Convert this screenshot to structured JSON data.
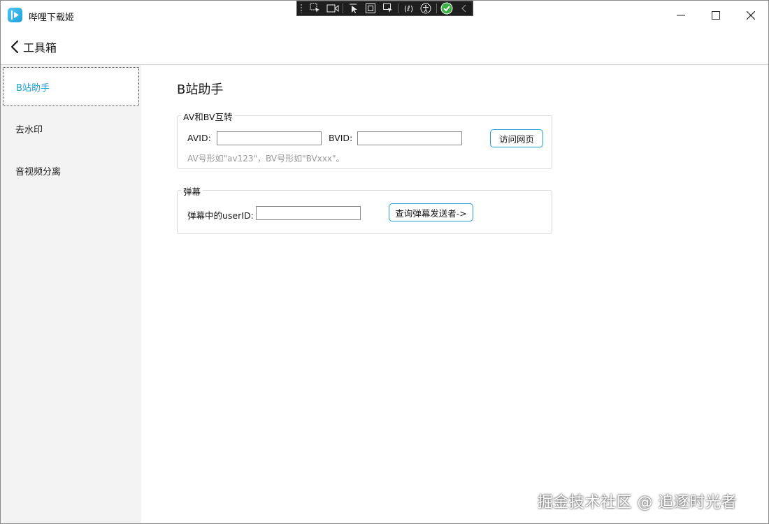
{
  "window": {
    "title": "哔哩下载姬"
  },
  "header": {
    "back_label": "工具箱"
  },
  "sidebar": {
    "items": [
      {
        "label": "B站助手",
        "active": true
      },
      {
        "label": "去水印",
        "active": false
      },
      {
        "label": "音视频分离",
        "active": false
      }
    ]
  },
  "main": {
    "title": "B站助手",
    "av_bv_group": {
      "legend": "AV和BV互转",
      "avid_label": "AVID:",
      "avid_value": "",
      "bvid_label": "BVID:",
      "bvid_value": "",
      "visit_button": "访问网页",
      "hint": "AV号形如\"av123\"，BV号形如\"BVxxx\"。"
    },
    "danmaku_group": {
      "legend": "弹幕",
      "userid_label": "弹幕中的userID:",
      "userid_value": "",
      "query_button": "查询弹幕发送者->"
    }
  },
  "watermark": "掘金技术社区 @ 追逐时光者",
  "colors": {
    "accent": "#1a9fd0",
    "sidebar_bg": "#f3f3f3",
    "hint_text": "#9a9a9a"
  }
}
